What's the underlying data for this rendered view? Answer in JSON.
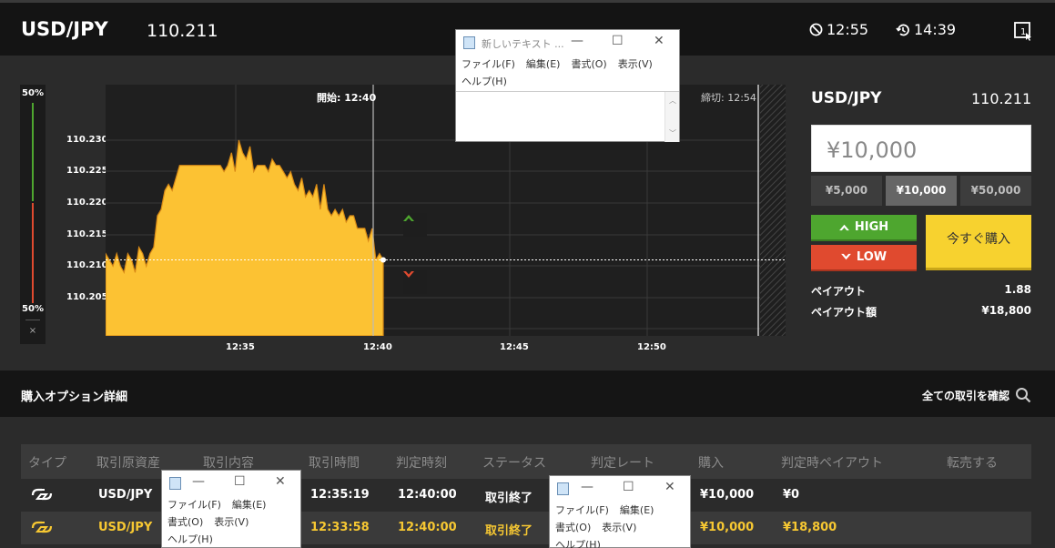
{
  "header": {
    "pair": "USD/JPY",
    "rate": "110.211",
    "clock1": "12:55",
    "clock2": "14:39"
  },
  "ratio": {
    "top": "50%",
    "bottom": "50%",
    "close": "×"
  },
  "chart_data": {
    "type": "area",
    "yticks": [
      "110.230",
      "110.225",
      "110.220",
      "110.215",
      "110.210",
      "110.205"
    ],
    "xticks": [
      "12:35",
      "12:40",
      "12:45",
      "12:50"
    ],
    "start_label": "開始: 12:40",
    "close_label": "締切: 12:54",
    "current_rate": 110.211,
    "ylim": [
      110.2,
      110.233
    ],
    "series": [
      {
        "values": [
          110.212,
          110.211,
          110.21,
          110.212,
          110.21,
          110.209,
          110.212,
          110.211,
          110.209,
          110.213,
          110.212,
          110.21,
          110.212,
          110.213,
          110.218,
          110.219,
          110.222,
          110.223,
          110.222,
          110.224,
          110.226,
          110.226,
          110.226,
          110.226,
          110.226,
          110.226,
          110.226,
          110.226,
          110.226,
          110.226,
          110.226,
          110.226,
          110.225,
          110.226,
          110.228,
          110.225,
          110.23,
          110.228,
          110.227,
          110.229,
          110.225,
          110.226,
          110.226,
          110.226,
          110.225,
          110.227,
          110.226,
          110.226,
          110.225,
          110.224,
          110.225,
          110.223,
          110.222,
          110.224,
          110.221,
          110.222,
          110.221,
          110.223,
          110.219,
          110.223,
          110.219,
          110.218,
          110.219,
          110.218,
          110.219,
          110.217,
          110.218,
          110.218,
          110.216,
          110.216,
          110.216,
          110.214,
          110.216,
          110.211,
          110.212,
          110.211
        ]
      }
    ]
  },
  "panel": {
    "pair": "USD/JPY",
    "rate": "110.211",
    "amount": "¥10,000",
    "quick": [
      "¥5,000",
      "¥10,000",
      "¥50,000"
    ],
    "high": "HIGH",
    "low": "LOW",
    "buy": "今すぐ購入",
    "payout_label": "ペイアウト",
    "payout_value": "1.88",
    "payout_amount_label": "ペイアウト額",
    "payout_amount_value": "¥18,800"
  },
  "detail": {
    "title": "購入オプション詳細",
    "link": "全ての取引を確認"
  },
  "table": {
    "headers": [
      "タイプ",
      "取引原資産",
      "取引内容",
      "取引時間",
      "判定時刻",
      "ステータス",
      "判定レート",
      "購入",
      "判定時ペイアウト",
      "転売する"
    ],
    "rows": [
      {
        "asset": "USD/JPY",
        "time": "12:35:19",
        "judge": "12:40:00",
        "status": "取引終了",
        "buy": "¥10,000",
        "payout": "¥0"
      },
      {
        "asset": "USD/JPY",
        "time": "12:33:58",
        "judge": "12:40:00",
        "status": "取引終了",
        "buy": "¥10,000",
        "payout": "¥18,800"
      }
    ]
  },
  "notepad1": {
    "title": "新しいテキスト ...",
    "menu1": [
      "ファイル(F)",
      "編集(E)",
      "書式(O)",
      "表示(V)"
    ],
    "menu2": "ヘルプ(H)"
  },
  "notepad2": {
    "menu1": [
      "ファイル(F)",
      "編集(E)"
    ],
    "menu2": [
      "書式(O)",
      "表示(V)"
    ],
    "menu3": "ヘルプ(H)"
  },
  "notepad3": {
    "menu1": [
      "ファイル(F)",
      "編集(E)"
    ],
    "menu2": [
      "書式(O)",
      "表示(V)"
    ],
    "menu3": "ヘルプ(H)"
  }
}
